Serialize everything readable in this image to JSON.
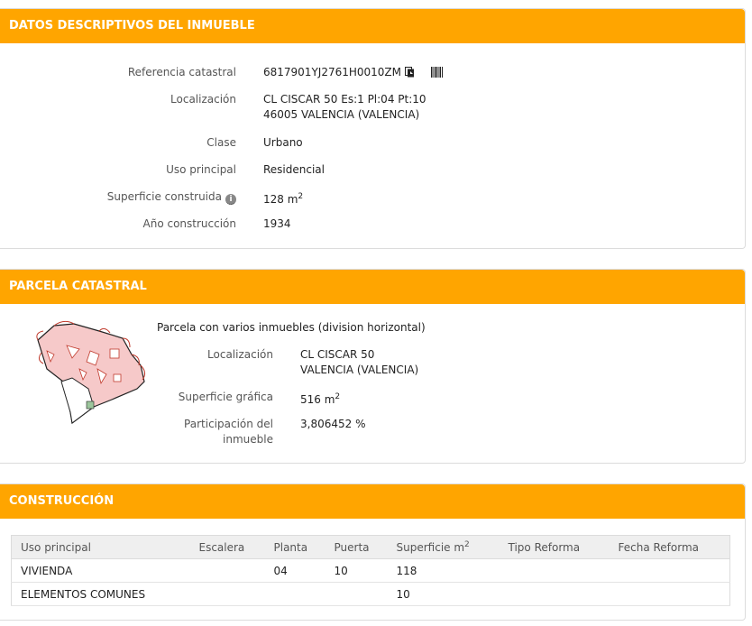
{
  "datos": {
    "title": "DATOS DESCRIPTIVOS DEL INMUEBLE",
    "referencia_label": "Referencia catastral",
    "referencia_value": "6817901YJ2761H0010ZM",
    "copy_icon": "copy-icon",
    "barcode_icon": "barcode-icon",
    "localizacion_label": "Localización",
    "localizacion_line1": "CL CISCAR 50 Es:1 Pl:04 Pt:10",
    "localizacion_line2": "46005 VALENCIA (VALENCIA)",
    "clase_label": "Clase",
    "clase_value": "Urbano",
    "uso_label": "Uso principal",
    "uso_value": "Residencial",
    "superficie_label": "Superficie construida",
    "superficie_value": "128 m",
    "superficie_unit_sup": "2",
    "anio_label": "Año construcción",
    "anio_value": "1934"
  },
  "parcela": {
    "title": "PARCELA CATASTRAL",
    "descripcion": "Parcela con varios inmuebles (division horizontal)",
    "localizacion_label": "Localización",
    "localizacion_line1": "CL CISCAR 50",
    "localizacion_line2": "VALENCIA (VALENCIA)",
    "superficie_label": "Superficie gráfica",
    "superficie_value": "516 m",
    "superficie_unit_sup": "2",
    "participacion_label_1": "Participación del",
    "participacion_label_2": "inmueble",
    "participacion_value": "3,806452 %",
    "colors": {
      "fill": "#f6c9c9",
      "stroke": "#c0392b",
      "outline": "#222222"
    }
  },
  "construccion": {
    "title": "CONSTRUCCIÓN",
    "headers": [
      "Uso principal",
      "Escalera",
      "Planta",
      "Puerta",
      "Superficie m",
      "Tipo Reforma",
      "Fecha Reforma"
    ],
    "header_sup": "2",
    "rows": [
      [
        "VIVIENDA",
        "",
        "04",
        "10",
        "118",
        "",
        ""
      ],
      [
        "ELEMENTOS COMUNES",
        "",
        "",
        "",
        "10",
        "",
        ""
      ]
    ]
  },
  "theme": {
    "accent": "#ffa500"
  }
}
